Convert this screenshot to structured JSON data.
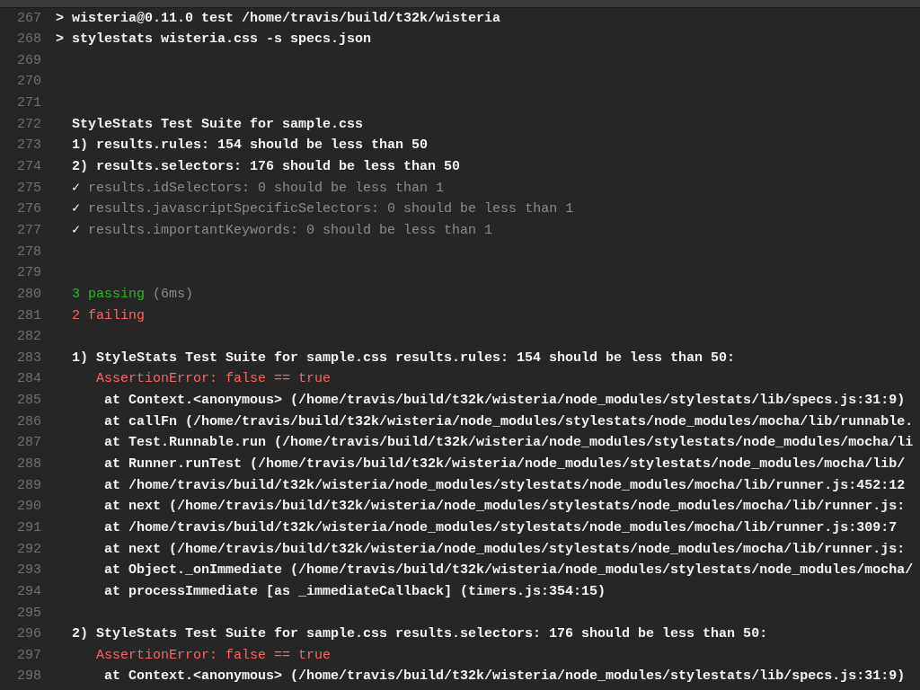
{
  "lines": [
    {
      "number": "267",
      "segments": [
        {
          "text": "> wisteria@0.11.0 test /home/travis/build/t32k/wisteria",
          "kind": "plain"
        }
      ]
    },
    {
      "number": "268",
      "segments": [
        {
          "text": "> stylestats wisteria.css -s specs.json",
          "kind": "plain"
        }
      ]
    },
    {
      "number": "269"
    },
    {
      "number": "270"
    },
    {
      "number": "271"
    },
    {
      "number": "272",
      "segments": [
        {
          "text": "  StyleStats Test Suite for sample.css",
          "kind": "plain"
        }
      ]
    },
    {
      "number": "273",
      "segments": [
        {
          "text": "  1) results.rules: 154 should be less than 50",
          "kind": "plain"
        }
      ]
    },
    {
      "number": "274",
      "segments": [
        {
          "text": "  2) results.selectors: 176 should be less than 50",
          "kind": "plain"
        }
      ]
    },
    {
      "number": "275",
      "segments": [
        {
          "text": "  ✓",
          "kind": "plain"
        },
        {
          "text": " results.idSelectors: 0 should be less than 1",
          "kind": "dim"
        }
      ]
    },
    {
      "number": "276",
      "segments": [
        {
          "text": "  ✓",
          "kind": "plain"
        },
        {
          "text": " results.javascriptSpecificSelectors: 0 should be less than 1",
          "kind": "dim"
        }
      ]
    },
    {
      "number": "277",
      "segments": [
        {
          "text": "  ✓",
          "kind": "plain"
        },
        {
          "text": " results.importantKeywords: 0 should be less than 1",
          "kind": "dim"
        }
      ]
    },
    {
      "number": "278"
    },
    {
      "number": "279"
    },
    {
      "number": "280",
      "segments": [
        {
          "text": "  3 passing",
          "kind": "pass"
        },
        {
          "text": " (6ms)",
          "kind": "dim"
        }
      ]
    },
    {
      "number": "281",
      "segments": [
        {
          "text": "  2 failing",
          "kind": "fail"
        }
      ]
    },
    {
      "number": "282"
    },
    {
      "number": "283",
      "segments": [
        {
          "text": "  1) StyleStats Test Suite for sample.css results.rules: 154 should be less than 50:",
          "kind": "plain"
        }
      ]
    },
    {
      "number": "284",
      "segments": [
        {
          "text": "     AssertionError: false == true",
          "kind": "fail"
        }
      ]
    },
    {
      "number": "285",
      "segments": [
        {
          "text": "      at Context.<anonymous> (/home/travis/build/t32k/wisteria/node_modules/stylestats/lib/specs.js:31:9)",
          "kind": "plain"
        }
      ]
    },
    {
      "number": "286",
      "segments": [
        {
          "text": "      at callFn (/home/travis/build/t32k/wisteria/node_modules/stylestats/node_modules/mocha/lib/runnable.",
          "kind": "plain"
        }
      ]
    },
    {
      "number": "287",
      "segments": [
        {
          "text": "      at Test.Runnable.run (/home/travis/build/t32k/wisteria/node_modules/stylestats/node_modules/mocha/li",
          "kind": "plain"
        }
      ]
    },
    {
      "number": "288",
      "segments": [
        {
          "text": "      at Runner.runTest (/home/travis/build/t32k/wisteria/node_modules/stylestats/node_modules/mocha/lib/",
          "kind": "plain"
        }
      ]
    },
    {
      "number": "289",
      "segments": [
        {
          "text": "      at /home/travis/build/t32k/wisteria/node_modules/stylestats/node_modules/mocha/lib/runner.js:452:12",
          "kind": "plain"
        }
      ]
    },
    {
      "number": "290",
      "segments": [
        {
          "text": "      at next (/home/travis/build/t32k/wisteria/node_modules/stylestats/node_modules/mocha/lib/runner.js:",
          "kind": "plain"
        }
      ]
    },
    {
      "number": "291",
      "segments": [
        {
          "text": "      at /home/travis/build/t32k/wisteria/node_modules/stylestats/node_modules/mocha/lib/runner.js:309:7",
          "kind": "plain"
        }
      ]
    },
    {
      "number": "292",
      "segments": [
        {
          "text": "      at next (/home/travis/build/t32k/wisteria/node_modules/stylestats/node_modules/mocha/lib/runner.js:",
          "kind": "plain"
        }
      ]
    },
    {
      "number": "293",
      "segments": [
        {
          "text": "      at Object._onImmediate (/home/travis/build/t32k/wisteria/node_modules/stylestats/node_modules/mocha/",
          "kind": "plain"
        }
      ]
    },
    {
      "number": "294",
      "segments": [
        {
          "text": "      at processImmediate [as _immediateCallback] (timers.js:354:15)",
          "kind": "plain"
        }
      ]
    },
    {
      "number": "295"
    },
    {
      "number": "296",
      "segments": [
        {
          "text": "  2) StyleStats Test Suite for sample.css results.selectors: 176 should be less than 50:",
          "kind": "plain"
        }
      ]
    },
    {
      "number": "297",
      "segments": [
        {
          "text": "     AssertionError: false == true",
          "kind": "fail"
        }
      ]
    },
    {
      "number": "298",
      "segments": [
        {
          "text": "      at Context.<anonymous> (/home/travis/build/t32k/wisteria/node_modules/stylestats/lib/specs.js:31:9)",
          "kind": "plain"
        }
      ]
    }
  ]
}
